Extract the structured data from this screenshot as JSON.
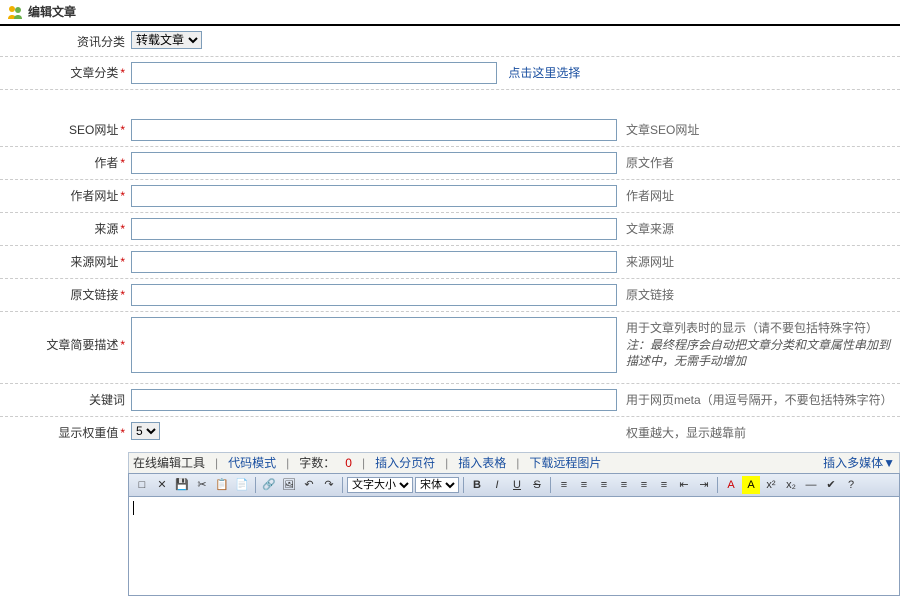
{
  "page_title": "编辑文章",
  "rows": {
    "info_cat": {
      "label": "资讯分类",
      "selected": "转载文章"
    },
    "article_cat": {
      "label": "文章分类",
      "link": "点击这里选择"
    },
    "seo": {
      "label": "SEO网址",
      "hint": "文章SEO网址"
    },
    "author": {
      "label": "作者",
      "hint": "原文作者"
    },
    "author_url": {
      "label": "作者网址",
      "hint": "作者网址"
    },
    "source": {
      "label": "来源",
      "hint": "文章来源"
    },
    "source_url": {
      "label": "来源网址",
      "hint": "来源网址"
    },
    "orig_link": {
      "label": "原文链接",
      "hint": "原文链接"
    },
    "summary": {
      "label": "文章简要描述",
      "hint1": "用于文章列表时的显示（请不要包括特殊字符）",
      "hint2": "注：最终程序会自动把文章分类和文章属性串加到描述中，无需手动增加"
    },
    "keywords": {
      "label": "关键词",
      "hint": "用于网页meta（用逗号隔开，不要包括特殊字符）"
    },
    "weight": {
      "label": "显示权重值",
      "selected": "5",
      "hint": "权重越大，显示越靠前"
    }
  },
  "editor": {
    "bar1": {
      "tool_label": "在线编辑工具",
      "code_mode": "代码模式",
      "char_count_label": "字数：",
      "char_count": "0",
      "insert_page": "插入分页符",
      "insert_table": "插入表格",
      "download_img": "下载远程图片",
      "insert_media": "插入多媒体▼"
    },
    "bar2": {
      "font_size": "文字大小",
      "font_family": "宋体"
    }
  },
  "icons": {
    "new": "□",
    "open": "✕",
    "save": "💾",
    "cut": "✂",
    "copy": "📋",
    "paste": "📄",
    "link": "🔗",
    "img": "🖼",
    "undo": "↶",
    "redo": "↷",
    "bold": "B",
    "italic": "I",
    "underline": "U",
    "strike": "S",
    "al": "≡",
    "ac": "≡",
    "ar": "≡",
    "aj": "≡",
    "ol": "≡",
    "ul": "≡",
    "out": "⇤",
    "ind": "⇥",
    "fc": "A",
    "bg": "A",
    "sup": "x²",
    "sub": "x₂",
    "hr": "—",
    "spell": "✔",
    "help": "?"
  }
}
